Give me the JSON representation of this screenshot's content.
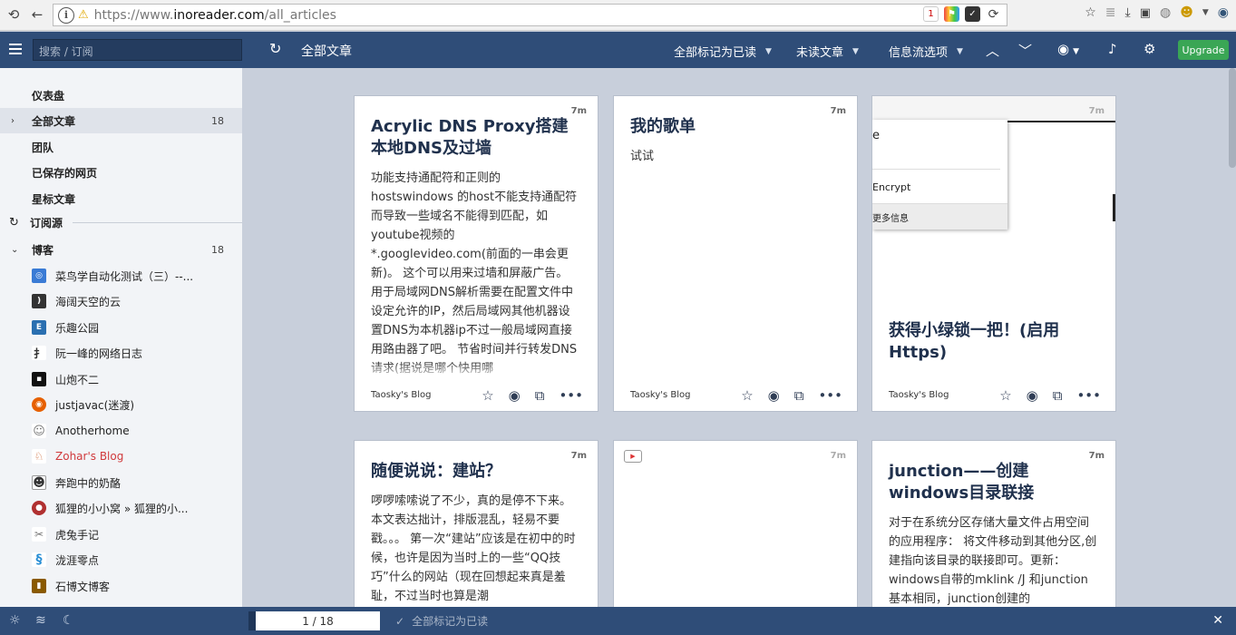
{
  "browser": {
    "url_prefix": "https://www.",
    "url_domain": "inoreader.com",
    "url_path": "/all_articles"
  },
  "header": {
    "search_placeholder": "搜索 / 订阅",
    "title": "全部文章",
    "mark_all_read": "全部标记为已读",
    "unread": "未读文章",
    "stream_options": "信息流选项",
    "upgrade": "Upgrade"
  },
  "sidebar": {
    "nav": [
      {
        "label": "仪表盘",
        "count": ""
      },
      {
        "label": "全部文章",
        "count": "18"
      },
      {
        "label": "团队",
        "count": ""
      },
      {
        "label": "已保存的网页",
        "count": ""
      },
      {
        "label": "星标文章",
        "count": ""
      }
    ],
    "subscriptions_label": "订阅源",
    "folder": {
      "label": "博客",
      "count": "18"
    },
    "feeds": [
      {
        "name": "菜鸟学自动化测试（三）--...",
        "icon": "bird-icon",
        "color": "#3a7bd5"
      },
      {
        "name": "海阔天空的云",
        "icon": "rss-icon",
        "color": "#333333"
      },
      {
        "name": "乐趣公园",
        "icon": "park-icon",
        "color": "#2a6fb0"
      },
      {
        "name": "阮一峰的网络日志",
        "icon": "brush-icon",
        "color": "#444444"
      },
      {
        "name": "山炮不二",
        "icon": "square-icon",
        "color": "#111111"
      },
      {
        "name": "justjavac(迷渡)",
        "icon": "firefox-icon",
        "color": "#e66000"
      },
      {
        "name": "Anotherhome",
        "icon": "face-icon",
        "color": "#888888"
      },
      {
        "name": "Zohar's Blog",
        "icon": "fox-icon",
        "color": "#cc6633"
      },
      {
        "name": "奔跑中的奶酪",
        "icon": "panda-icon",
        "color": "#333333"
      },
      {
        "name": "狐狸的小小窝 » 狐狸的小...",
        "icon": "fox2-icon",
        "color": "#b03030"
      },
      {
        "name": "虎兔手记",
        "icon": "rabbit-icon",
        "color": "#777777"
      },
      {
        "name": "泷涯零点",
        "icon": "s-icon",
        "color": "#2a8fd5"
      },
      {
        "name": "石博文博客",
        "icon": "book-icon",
        "color": "#8a5a00"
      }
    ]
  },
  "cards": [
    {
      "age": "7m",
      "title": "Acrylic DNS Proxy搭建本地DNS及过墙",
      "body": "功能支持通配符和正则的hostswindows 的host不能支持通配符而导致一些域名不能得到匹配，如youtube视频的*.googlevideo.com(前面的一串会更新)。 这个可以用来过墙和屏蔽广告。 用于局域网DNS解析需要在配置文件中设定允许的IP，然后局域网其他机器设置DNS为本机器ip不过一般局域网直接用路由器了吧。 节省时间并行转发DNS请求(据说是哪个快用哪",
      "source": "Taosky's Blog"
    },
    {
      "age": "7m",
      "title": "我的歌单",
      "body": "试试",
      "source": "Taosky's Blog"
    },
    {
      "age": "7m",
      "title": "获得小绿锁一把！(启用Https)",
      "body": "",
      "source": "Taosky's Blog",
      "image_lines": [
        "e",
        "Encrypt",
        "更多信息"
      ]
    },
    {
      "age": "7m",
      "title": "随便说说：建站？",
      "body": "啰啰嗦嗦说了不少，真的是停不下来。 本文表达拙计，排版混乱，轻易不要戳。。。 第一次“建站”应该是在初中的时候，也许是因为当时上的一些“QQ技巧”什么的网站（现在回想起来真是羞耻，不过当时也算是潮",
      "source": ""
    },
    {
      "age": "7m",
      "title": "",
      "body": "",
      "source": ""
    },
    {
      "age": "7m",
      "title": "junction——创建windows目录联接",
      "body": "对于在系统分区存储大量文件占用空间的应用程序： 将文件移动到其他分区,创建指向该目录的联接即可。更新：windows自带的mklink /J 和junction基本相同，junction创建的",
      "source": ""
    }
  ],
  "footer": {
    "pager": "1 / 18",
    "mark_all_read": "全部标记为已读"
  }
}
